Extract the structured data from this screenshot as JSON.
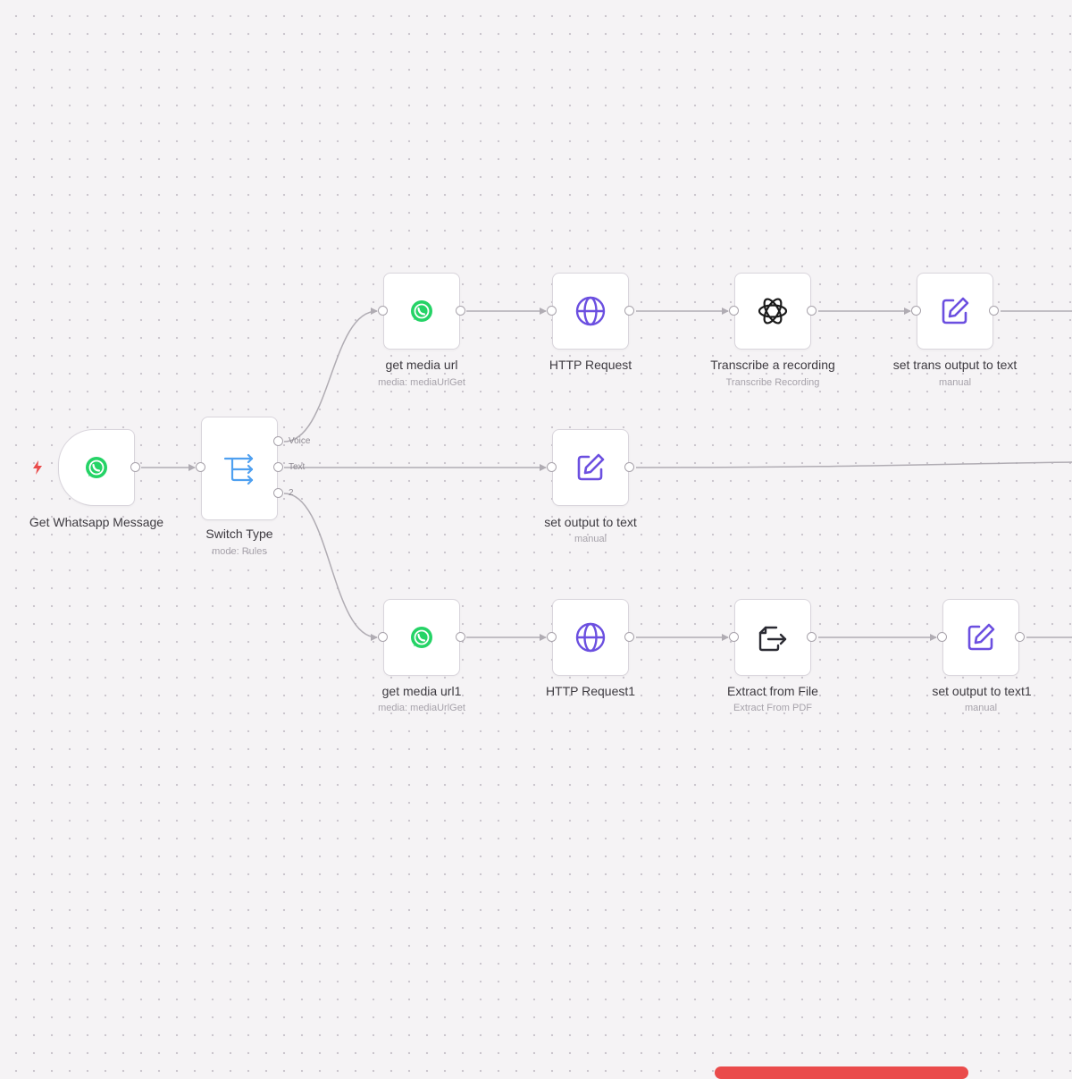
{
  "workflow": {
    "nodes": [
      {
        "key": "trigger",
        "label": "Get Whatsapp Message",
        "sub": "",
        "icon": "whatsapp-icon"
      },
      {
        "key": "switch",
        "label": "Switch Type",
        "sub": "mode: Rules",
        "icon": "switch-icon"
      },
      {
        "key": "getmedia",
        "label": "get media url",
        "sub": "media: mediaUrlGet",
        "icon": "whatsapp-icon"
      },
      {
        "key": "http",
        "label": "HTTP Request",
        "sub": "",
        "icon": "globe-icon"
      },
      {
        "key": "transcribe",
        "label": "Transcribe a recording",
        "sub": "Transcribe Recording",
        "icon": "openai-icon"
      },
      {
        "key": "settrans",
        "label": "set trans output to text",
        "sub": "manual",
        "icon": "edit-icon"
      },
      {
        "key": "setoutput",
        "label": "set output to text",
        "sub": "manual",
        "icon": "edit-icon"
      },
      {
        "key": "getmedia1",
        "label": "get media url1",
        "sub": "media: mediaUrlGet",
        "icon": "whatsapp-icon"
      },
      {
        "key": "http1",
        "label": "HTTP Request1",
        "sub": "",
        "icon": "globe-icon"
      },
      {
        "key": "extract",
        "label": "Extract from File",
        "sub": "Extract From PDF",
        "icon": "file-export-icon"
      },
      {
        "key": "setoutput1",
        "label": "set output to text1",
        "sub": "manual",
        "icon": "edit-icon"
      }
    ],
    "switch_outputs": [
      "Voice",
      "Text",
      "2"
    ]
  },
  "colors": {
    "whatsapp": "#25d366",
    "accent": "#6b4fe0",
    "switch": "#4fa0f0",
    "edge": "#b0acb3",
    "trigger_bolt": "#ea4b4b"
  }
}
